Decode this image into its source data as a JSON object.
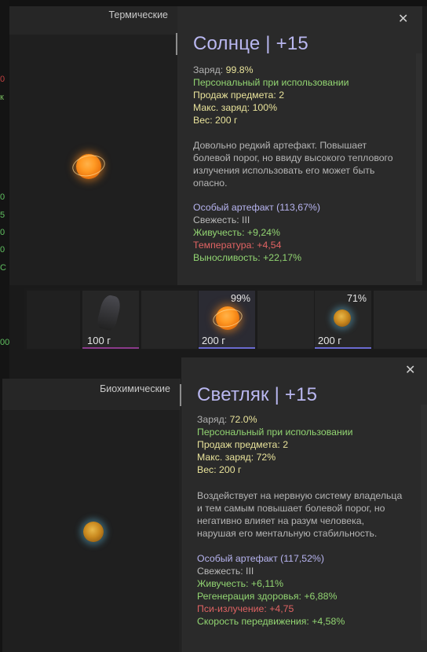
{
  "card1": {
    "category": "Термические",
    "title": "Солнце | +15",
    "close_icon": "close-icon",
    "stats": [
      {
        "label": "Заряд: ",
        "value": "99.8%"
      },
      {
        "text": "Персональный при использовании"
      },
      {
        "text": "Продаж предмета: 2"
      },
      {
        "text": "Макс. заряд: 100%"
      },
      {
        "text": "Вес: 200 г"
      }
    ],
    "description": [
      "Довольно редкий артефакт. Повышает",
      "болевой порог, но ввиду высокого теплового",
      "излучения использовать его может быть",
      "опасно."
    ],
    "special": "Особый артефакт (113,67%)",
    "freshness": "Свежесть: III",
    "effects": [
      {
        "text": "Живучесть: +9,24%",
        "kind": "positive"
      },
      {
        "text": "Температура: +4,54",
        "kind": "negative"
      },
      {
        "text": "Выносливость: +22,17%",
        "kind": "positive"
      }
    ]
  },
  "inventory": {
    "cells": [
      {
        "weight": "100 г",
        "percent": "",
        "icon": "dark-artifact-icon",
        "bar_color": "#8a3a8a"
      },
      {
        "weight": "",
        "percent": "",
        "icon": "",
        "bar_color": ""
      },
      {
        "weight": "200 г",
        "percent": "99%",
        "icon": "sun-artifact-icon",
        "bar_color": "#6a6ad0"
      },
      {
        "weight": "",
        "percent": "",
        "icon": "",
        "bar_color": ""
      },
      {
        "weight": "200 г",
        "percent": "71%",
        "icon": "firefly-artifact-icon",
        "bar_color": "#6a6ad0"
      },
      {
        "weight": "",
        "percent": "",
        "icon": "",
        "bar_color": ""
      }
    ]
  },
  "card2": {
    "category": "Биохимические",
    "title": "Светляк | +15",
    "close_icon": "close-icon",
    "stats": [
      {
        "label": "Заряд: ",
        "value": "72.0%"
      },
      {
        "text": "Персональный при использовании"
      },
      {
        "text": "Продаж предмета: 2"
      },
      {
        "text": "Макс. заряд: 72%"
      },
      {
        "text": "Вес: 200 г"
      }
    ],
    "description": [
      "Воздействует на нервную систему владельца",
      "и тем самым повышает болевой порог, но",
      "негативно влияет на разум человека,",
      "нарушая его ментальную стабильность."
    ],
    "special": "Особый артефакт (117,52%)",
    "freshness": "Свежесть: III",
    "effects": [
      {
        "text": "Живучесть: +6,11%",
        "kind": "positive"
      },
      {
        "text": "Регенерация здоровья: +6,88%",
        "kind": "positive"
      },
      {
        "text": "Пси-излучение: +4,75",
        "kind": "negative"
      },
      {
        "text": "Скорость передвижения: +4,58%",
        "kind": "positive"
      }
    ]
  },
  "colors": {
    "title": "#b9b7f0",
    "charge_value": "#e8e29a",
    "positive": "#92d572",
    "negative": "#e06363",
    "special": "#b7b4f0"
  }
}
